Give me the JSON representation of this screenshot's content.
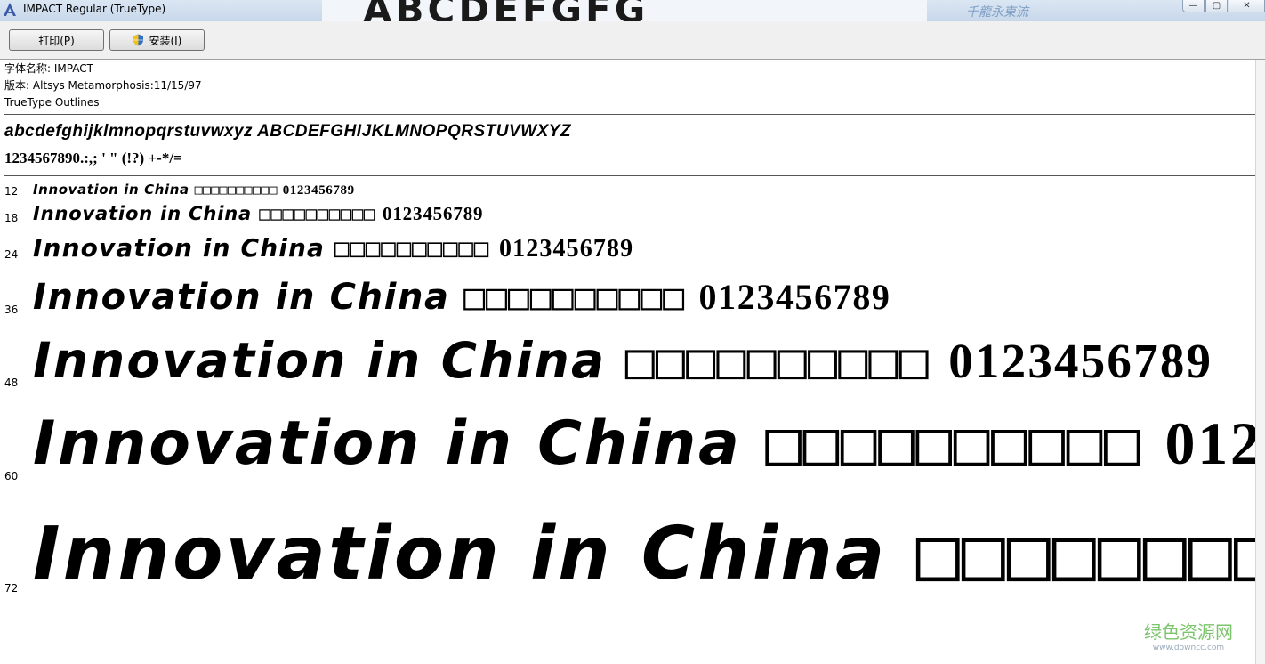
{
  "window": {
    "title": "IMPACT Regular (TrueType)",
    "background_banner_text": "ABCDEFGFG",
    "background_banner_hand": "千龍永東流",
    "controls": [
      "—",
      "▢",
      "✕"
    ]
  },
  "toolbar": {
    "print_label": "打印(P)",
    "install_label": "安装(I)"
  },
  "font_info": {
    "name_line": "字体名称: IMPACT",
    "version_line": "版本: Altsys Metamorphosis:11/15/97",
    "type_line": "TrueType Outlines"
  },
  "charset": {
    "alphabet": "abcdefghijklmnopqrstuvwxyz ABCDEFGHIJKLMNOPQRSTUVWXYZ",
    "digits_symbols": "1234567890.:,; ' \" (!?) +-*/="
  },
  "samples": {
    "text": "Innovation in China",
    "boxes": "□□□□□□□□□□",
    "digits": "0123456789",
    "sizes": [
      "12",
      "18",
      "24",
      "36",
      "48",
      "60",
      "72"
    ]
  },
  "watermark": {
    "name": "绿色资源网",
    "url": "www.downcc.com"
  },
  "colors": {
    "titlebar": "#c7d7ea",
    "toolbar": "#f0f0f0",
    "watermark": "#7cc46b"
  }
}
